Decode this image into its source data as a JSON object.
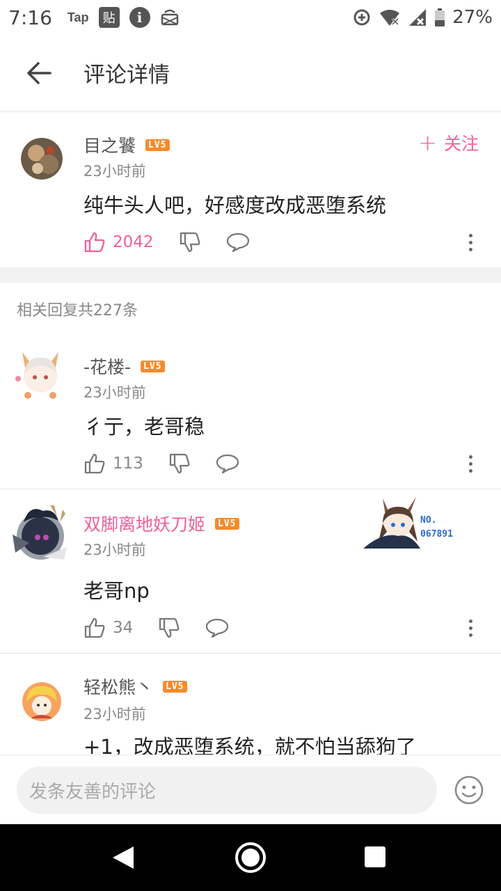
{
  "status_bar": {
    "time": "7:16",
    "tap_label": "Tap",
    "tie_label": "贴",
    "info_label": "i",
    "battery": "27%"
  },
  "header": {
    "title": "评论详情"
  },
  "main_comment": {
    "username": "目之饕",
    "level": "LV5",
    "time": "23小时前",
    "text": "纯牛头人吧，好感度改成恶堕系统",
    "likes": "2042",
    "follow_label": "关注"
  },
  "replies_title": "相关回复共227条",
  "replies": [
    {
      "username": "-花楼-",
      "level": "LV5",
      "time": "23小时前",
      "text": "彳亍，老哥稳",
      "likes": "113"
    },
    {
      "username": "双脚离地妖刀姬",
      "level": "LV5",
      "time": "23小时前",
      "text": "老哥np",
      "likes": "34",
      "badge_number": "NO.\n067891"
    },
    {
      "username": "轻松熊丶",
      "level": "LV5",
      "time": "23小时前",
      "text": "+1，改成恶堕系统，就不怕当舔狗了"
    }
  ],
  "input": {
    "placeholder": "发条友善的评论"
  },
  "colors": {
    "accent_pink": "#f0609a",
    "level_orange": "#f58b2c",
    "badge_blue": "#2a6bd6"
  }
}
